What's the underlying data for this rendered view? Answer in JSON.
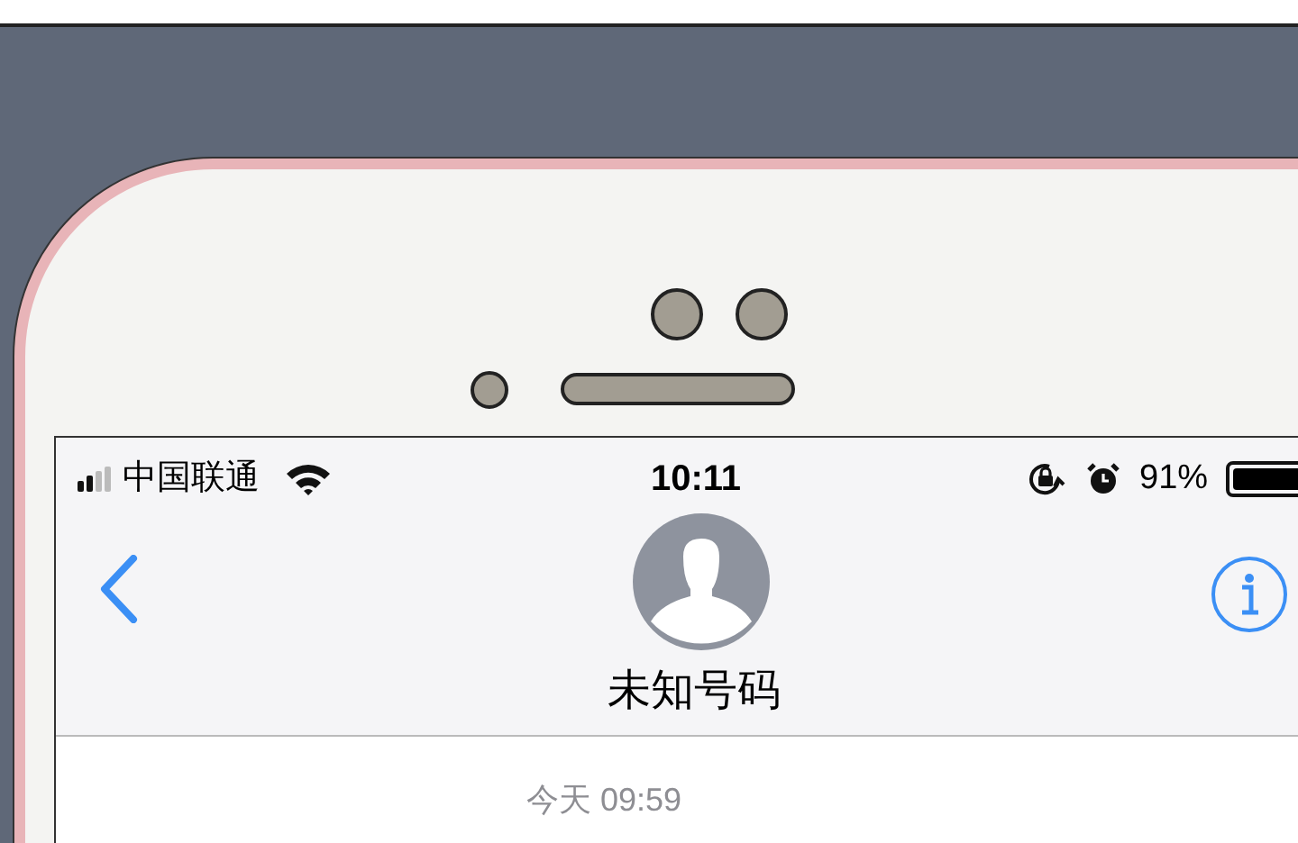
{
  "status_bar": {
    "carrier": "中国联通",
    "time": "10:11",
    "battery": "91%"
  },
  "header": {
    "title": "未知号码"
  },
  "conversation": {
    "timestamp": "今天 09:59"
  }
}
